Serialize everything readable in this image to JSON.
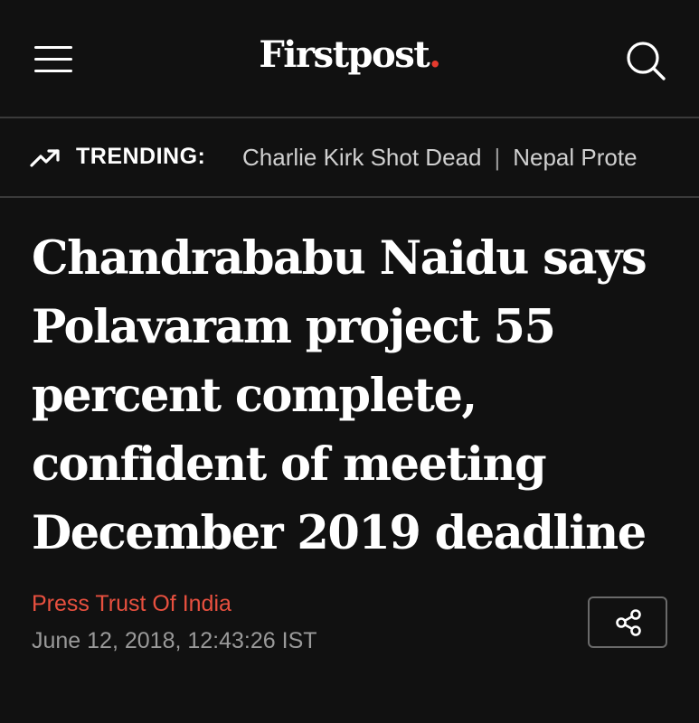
{
  "header": {
    "menu_icon": "hamburger-menu-icon",
    "logo_text": "Firstpost",
    "logo_dot": ".",
    "logo_dot_color": "#e63b2e",
    "search_icon": "search-icon"
  },
  "trending": {
    "icon": "trending-up-icon",
    "label": "TRENDING:",
    "items": [
      "Charlie Kirk Shot Dead",
      "Nepal Prote"
    ],
    "separator": "|"
  },
  "article": {
    "headline": "Chandrababu Naidu says Polavaram project 55 percent complete, confident of meeting December 2019 deadline",
    "author": "Press Trust Of India",
    "author_color": "#e8503f",
    "date": "June 12, 2018, 12:43:26 IST",
    "share_icon": "share-icon"
  },
  "colors": {
    "background": "#111111",
    "divider": "#3a3a3a"
  }
}
